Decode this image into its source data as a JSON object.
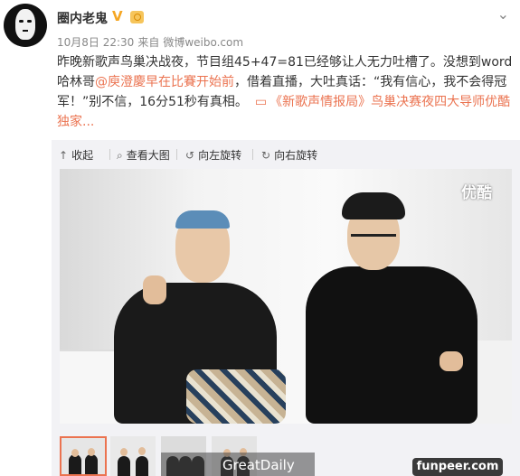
{
  "post": {
    "username": "圈内老鬼",
    "date": "10月8日 22:30",
    "source_prefix": "来自",
    "source": "微博weibo.com",
    "text_part1": "昨晚新歌声鸟巢决战夜，节目组45+47=81已经够让人无力吐槽了。没想到word哈林哥",
    "mention": "@庾澄慶早在比賽开始前",
    "text_part2": "，借着直播，大吐真话：“我有信心，我不会得冠军！”别不信，16分51秒有真相。",
    "topic": "《新歌声情报局》鸟巢决赛夜四大导师优酷独家...",
    "verified_mark": "V"
  },
  "toolbar": {
    "collapse": "收起",
    "view_large": "查看大图",
    "rotate_left": "向左旋转",
    "rotate_right": "向右旋转"
  },
  "media": {
    "watermark": "优酷",
    "overlay_text": "GreatDaily",
    "site_badge": "funpeer.com"
  },
  "colors": {
    "accent": "#eb7350",
    "card_bg": "#f2f2f5",
    "text": "#333333",
    "meta": "#888888"
  }
}
